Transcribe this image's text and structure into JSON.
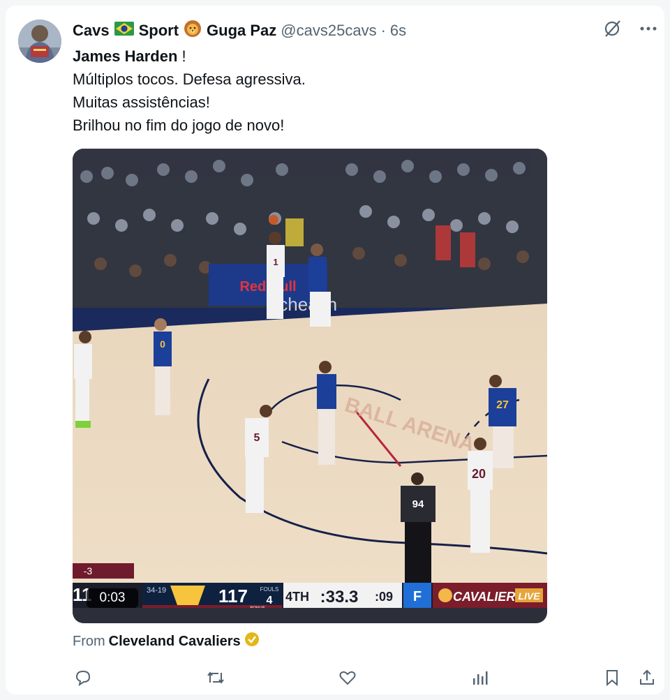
{
  "author": {
    "display_name_parts": [
      "Cavs",
      "Sport",
      "Guga Paz"
    ],
    "handle": "@cavs25cavs",
    "separator": "·",
    "time_ago": "6s"
  },
  "post": {
    "lines": [
      {
        "strong": "James Harden",
        "rest": " !"
      },
      {
        "text": "Múltiplos tocos. Defesa agressiva."
      },
      {
        "text": "Muitas assistências!"
      },
      {
        "text": "Brilhou no fim do jogo de novo!"
      }
    ]
  },
  "media": {
    "video_timer": "0:03",
    "scoreboard": {
      "diff": "-3",
      "cavs_score_partial": "11",
      "nuggets_record": "34-19",
      "nuggets_score": "117",
      "fouls_label": "FOULS",
      "fouls": "4",
      "bonus_label": "BONUS",
      "period": "4TH",
      "clock": ":33.3",
      "shot_clock": ":09",
      "broadcast": "CAVALIERS",
      "broadcast_live": "LIVE"
    },
    "court_text": {
      "sponsor": "Red Bull",
      "baseline": "uchealth",
      "ball_arena_text": "BALL ARENA"
    },
    "jerseys": {
      "harden": "1",
      "mitchell": "5",
      "allen_like": "20",
      "referee": "94",
      "nuggets_27": "27",
      "nuggets_0": "0"
    }
  },
  "source": {
    "prefix": "From",
    "org": "Cleveland Cavaliers"
  },
  "colors": {
    "link_gray": "#536471",
    "text": "#0f1419",
    "verified_gold": "#e2b719"
  },
  "icons": [
    "grok-icon",
    "more-icon",
    "reply-icon",
    "repost-icon",
    "like-icon",
    "views-icon",
    "bookmark-icon",
    "share-icon",
    "verified-badge-icon",
    "brazil-flag-icon",
    "lion-icon"
  ]
}
